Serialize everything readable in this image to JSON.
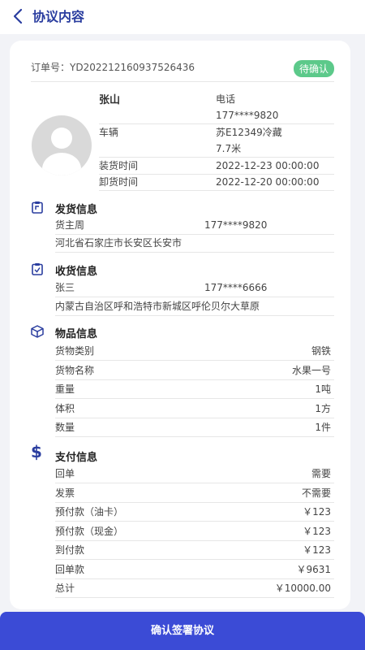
{
  "header": {
    "title": "协议内容",
    "back_icon": "chevron-left-icon"
  },
  "order": {
    "label": "订单号：",
    "number": "YD202212160937526436",
    "status": "待确认"
  },
  "driver": {
    "name": "张山",
    "phone_label": "电话",
    "phone": "177****9820",
    "vehicle_label": "车辆",
    "vehicle": "苏E12349冷藏",
    "vehicle_length": "7.7米",
    "load_label": "装货时间",
    "load_time": "2022-12-23 00:00:00",
    "unload_label": "卸货时间",
    "unload_time": "2022-12-20 00:00:00"
  },
  "shipping": {
    "title": "发货信息",
    "name": "货主周",
    "phone": "177****9820",
    "address": "河北省石家庄市长安区长安市"
  },
  "receiving": {
    "title": "收货信息",
    "name": "张三",
    "phone": "177****6666",
    "address": "内蒙古自治区呼和浩特市新城区呼伦贝尔大草原"
  },
  "goods": {
    "title": "物品信息",
    "rows": [
      {
        "label": "货物类别",
        "value": "钢铁"
      },
      {
        "label": "货物名称",
        "value": "水果一号"
      },
      {
        "label": "重量",
        "value": "1吨"
      },
      {
        "label": "体积",
        "value": "1方"
      },
      {
        "label": "数量",
        "value": "1件"
      }
    ]
  },
  "payment": {
    "title": "支付信息",
    "rows": [
      {
        "label": "回单",
        "value": "需要"
      },
      {
        "label": "发票",
        "value": "不需要"
      },
      {
        "label": "预付款（油卡）",
        "value": "￥123"
      },
      {
        "label": "预付款（现金）",
        "value": "￥123"
      },
      {
        "label": "到付款",
        "value": "￥123"
      },
      {
        "label": "回单款",
        "value": "￥9631"
      },
      {
        "label": "总计",
        "value": "￥10000.00"
      }
    ]
  },
  "footer": {
    "confirm_label": "确认签署协议"
  },
  "colors": {
    "accent": "#3b4bd6",
    "title": "#2a3d9f",
    "badge": "#5cc98a"
  }
}
